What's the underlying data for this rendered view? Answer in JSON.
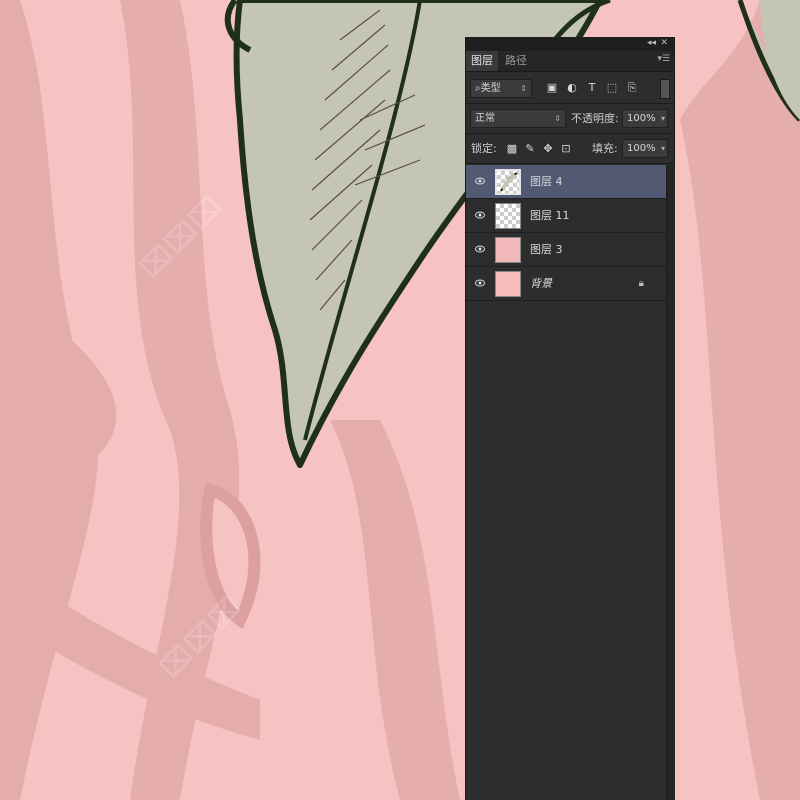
{
  "colors": {
    "canvas_bg": "#f6c2c2",
    "stripe": "#e3a6a6",
    "leaf_fill": "#c5c5b5",
    "leaf_outline": "#1e3118",
    "panel_bg": "#2d2d2d",
    "selected_layer": "#525a73"
  },
  "panel": {
    "tabs": [
      {
        "label": "图层",
        "active": true
      },
      {
        "label": "路径",
        "active": false
      }
    ],
    "filter": {
      "kind_label": "类型",
      "icons": [
        "image-filter-icon",
        "adjustment-filter-icon",
        "text-filter-icon",
        "shape-filter-icon",
        "smart-object-filter-icon"
      ]
    },
    "blend": {
      "mode": "正常",
      "opacity_label": "不透明度:",
      "opacity_value": "100%"
    },
    "lock": {
      "label": "锁定:",
      "fill_label": "填充:",
      "fill_value": "100%"
    },
    "layers": [
      {
        "name": "图层 4",
        "selected": true,
        "thumb": "leaf"
      },
      {
        "name": "图层 11",
        "selected": false,
        "thumb": "checker"
      },
      {
        "name": "图层 3",
        "selected": false,
        "thumb": "pink"
      },
      {
        "name": "背景",
        "selected": false,
        "thumb": "solid",
        "locked": true
      }
    ]
  }
}
